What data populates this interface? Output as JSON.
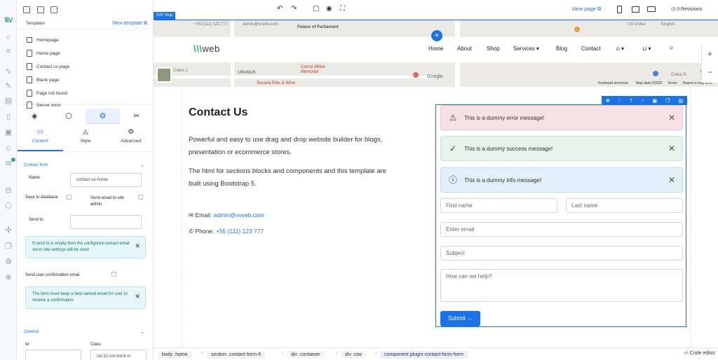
{
  "rail": {
    "logo": "\\\\\\V"
  },
  "panel": {
    "templates_label": "Templates",
    "new_template": "New template",
    "pages": [
      "Homepage",
      "Home page",
      "Contact us page",
      "Blank page",
      "Page not found",
      "Server error"
    ],
    "subtabs": [
      "Content",
      "Style",
      "Advanced"
    ],
    "contact_form_title": "Contact form",
    "name_label": "Name",
    "name_value": "contact-us-home",
    "save_db_label": "Save to database",
    "send_admin_label": "Send email to site admin",
    "send_to_label": "Send to",
    "send_to_value": "",
    "alert1": "If send to is empty then the configured contact email set in site settings will be used",
    "confirm_label": "Send user confirmation email",
    "alert2": "The form must keep a field named email for user to receive a confirmation",
    "general_title": "General",
    "id_label": "Id",
    "class_label": "Class",
    "class_value": "col-12 col-md-6 m"
  },
  "topbar": {
    "view_page": "View page",
    "revisions": "0 Revisions"
  },
  "canvas": {
    "div_badge": "DIV #top",
    "map_labels": [
      "+55 (111) 123 777",
      "admin@vvveb.com",
      "Palace of Parliament",
      "Calea 1",
      "URANUS",
      "Cercul Militar Memorial",
      "Suzana Ribs & Wine",
      "Google",
      "Keyboard shortcuts",
      "Map data ©2023",
      "Terms",
      "Report a map error",
      "US Dollar",
      "English",
      "Calea D"
    ],
    "brand": "web",
    "nav": [
      "Home",
      "About",
      "Shop",
      "Services",
      "Blog",
      "Contact"
    ],
    "title": "Contact Us",
    "lead1": "Powerful and easy to use drag and drop website builder for blogs, presentation or ecommerce stores.",
    "lead2": "The html for sections blocks and components and this template are built using Bootstrap 5.",
    "email_label": "Email:",
    "email": "admin@vvveb.com",
    "phone_label": "Phone:",
    "phone": "+55 (111) 123 777",
    "err_msg": "This is a dummy error message!",
    "ok_msg": "This is a dummy success message!",
    "info_msg": "This is a dummy info message!",
    "first_name": "First name",
    "last_name": "Last name",
    "email_ph": "Enter email",
    "subject_ph": "Subject",
    "help_ph": "How can we help?",
    "submit": "Submit →"
  },
  "breadcrumb": [
    "body .home",
    "section .contact-form-6",
    "div .container",
    "div .row",
    "component plugin-contact-form-form"
  ],
  "code_editor": "Code editor"
}
